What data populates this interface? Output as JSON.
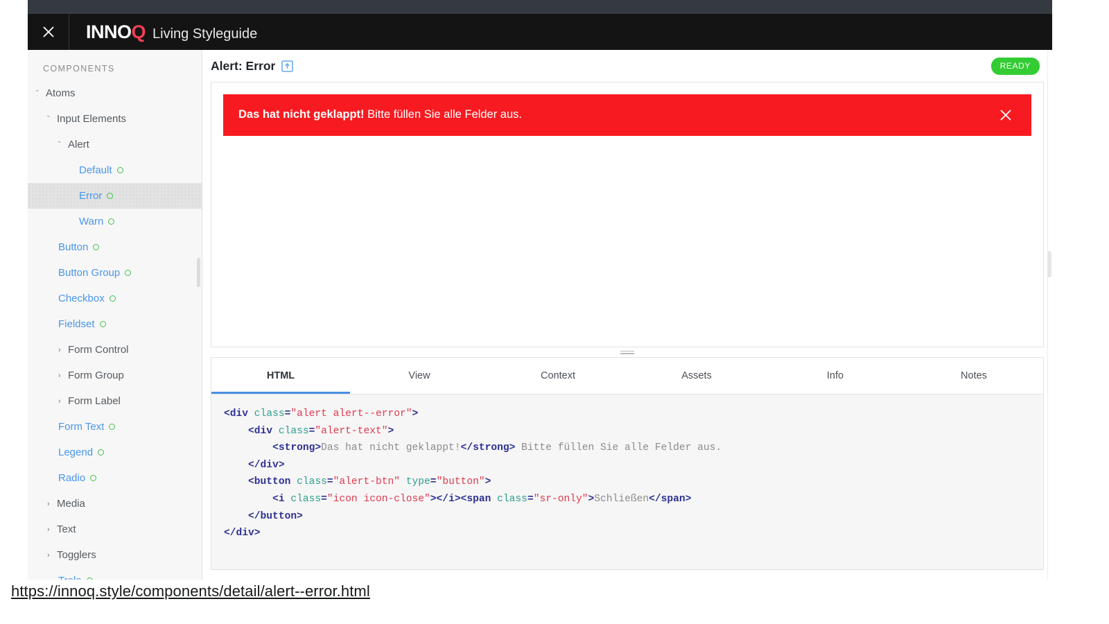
{
  "app": {
    "close_label": "×",
    "brand_main": "INNO",
    "brand_accent": "Q",
    "brand_sub": "Living Styleguide",
    "accent_color": "#ef4056",
    "header_bg": "#141414"
  },
  "sidebar": {
    "title": "COMPONENTS",
    "items": [
      {
        "label": "Atoms",
        "level": 0,
        "type": "branch",
        "expanded": true,
        "active": false
      },
      {
        "label": "Input Elements",
        "level": 1,
        "type": "branch",
        "expanded": true,
        "active": false
      },
      {
        "label": "Alert",
        "level": 2,
        "type": "branch",
        "expanded": true,
        "active": false
      },
      {
        "label": "Default",
        "level": 3,
        "type": "leaf",
        "status": "ready",
        "active": false
      },
      {
        "label": "Error",
        "level": 3,
        "type": "leaf",
        "status": "ready",
        "active": true
      },
      {
        "label": "Warn",
        "level": 3,
        "type": "leaf",
        "status": "ready",
        "active": false
      },
      {
        "label": "Button",
        "level": 2,
        "type": "leaf",
        "status": "ready",
        "active": false
      },
      {
        "label": "Button Group",
        "level": 2,
        "type": "leaf",
        "status": "ready",
        "active": false
      },
      {
        "label": "Checkbox",
        "level": 2,
        "type": "leaf",
        "status": "ready",
        "active": false
      },
      {
        "label": "Fieldset",
        "level": 2,
        "type": "leaf",
        "status": "ready",
        "active": false
      },
      {
        "label": "Form Control",
        "level": 2,
        "type": "branch",
        "expanded": false,
        "active": false
      },
      {
        "label": "Form Group",
        "level": 2,
        "type": "branch",
        "expanded": false,
        "active": false
      },
      {
        "label": "Form Label",
        "level": 2,
        "type": "branch",
        "expanded": false,
        "active": false
      },
      {
        "label": "Form Text",
        "level": 2,
        "type": "leaf",
        "status": "ready",
        "active": false
      },
      {
        "label": "Legend",
        "level": 2,
        "type": "leaf",
        "status": "ready",
        "active": false
      },
      {
        "label": "Radio",
        "level": 2,
        "type": "leaf",
        "status": "ready",
        "active": false
      },
      {
        "label": "Media",
        "level": 1,
        "type": "branch",
        "expanded": false,
        "active": false
      },
      {
        "label": "Text",
        "level": 1,
        "type": "branch",
        "expanded": false,
        "active": false
      },
      {
        "label": "Togglers",
        "level": 1,
        "type": "branch",
        "expanded": false,
        "active": false
      },
      {
        "label": "Trolo",
        "level": 2,
        "type": "leaf",
        "status": "ready",
        "active": false
      }
    ],
    "status_color": "#3fc14a",
    "link_color": "#4a96e8"
  },
  "main": {
    "title": "Alert: Error",
    "open_icon": "open-in-new-icon",
    "badge": "READY",
    "badge_color": "#33cc33"
  },
  "preview": {
    "alert": {
      "strong_text": "Das hat nicht geklappt!",
      "rest_text": " Bitte füllen Sie alle Felder aus.",
      "bg_color": "#f71b21",
      "close_label": "Schließen"
    }
  },
  "tabs": [
    {
      "label": "HTML",
      "active": true
    },
    {
      "label": "View",
      "active": false
    },
    {
      "label": "Context",
      "active": false
    },
    {
      "label": "Assets",
      "active": false
    },
    {
      "label": "Info",
      "active": false
    },
    {
      "label": "Notes",
      "active": false
    }
  ],
  "code": {
    "language": "html",
    "lines": [
      [
        {
          "t": "tag",
          "v": "<div "
        },
        {
          "t": "attr",
          "v": "class"
        },
        {
          "t": "tag",
          "v": "="
        },
        {
          "t": "val",
          "v": "\"alert alert--error\""
        },
        {
          "t": "tag",
          "v": ">"
        }
      ],
      [
        {
          "t": "plain",
          "v": "    "
        },
        {
          "t": "tag",
          "v": "<div "
        },
        {
          "t": "attr",
          "v": "class"
        },
        {
          "t": "tag",
          "v": "="
        },
        {
          "t": "val",
          "v": "\"alert-text\""
        },
        {
          "t": "tag",
          "v": ">"
        }
      ],
      [
        {
          "t": "plain",
          "v": "        "
        },
        {
          "t": "tag",
          "v": "<strong>"
        },
        {
          "t": "txt",
          "v": "Das hat nicht geklappt!"
        },
        {
          "t": "tag",
          "v": "</strong>"
        },
        {
          "t": "txt",
          "v": " Bitte füllen Sie alle Felder aus."
        }
      ],
      [
        {
          "t": "plain",
          "v": "    "
        },
        {
          "t": "tag",
          "v": "</div>"
        }
      ],
      [
        {
          "t": "plain",
          "v": "    "
        },
        {
          "t": "tag",
          "v": "<button "
        },
        {
          "t": "attr",
          "v": "class"
        },
        {
          "t": "tag",
          "v": "="
        },
        {
          "t": "val",
          "v": "\"alert-btn\""
        },
        {
          "t": "plain",
          "v": " "
        },
        {
          "t": "attr",
          "v": "type"
        },
        {
          "t": "tag",
          "v": "="
        },
        {
          "t": "val",
          "v": "\"button\""
        },
        {
          "t": "tag",
          "v": ">"
        }
      ],
      [
        {
          "t": "plain",
          "v": "        "
        },
        {
          "t": "tag",
          "v": "<i "
        },
        {
          "t": "attr",
          "v": "class"
        },
        {
          "t": "tag",
          "v": "="
        },
        {
          "t": "val",
          "v": "\"icon icon-close\""
        },
        {
          "t": "tag",
          "v": "></i><span "
        },
        {
          "t": "attr",
          "v": "class"
        },
        {
          "t": "tag",
          "v": "="
        },
        {
          "t": "val",
          "v": "\"sr-only\""
        },
        {
          "t": "tag",
          "v": ">"
        },
        {
          "t": "txt",
          "v": "Schließen"
        },
        {
          "t": "tag",
          "v": "</span>"
        }
      ],
      [
        {
          "t": "plain",
          "v": "    "
        },
        {
          "t": "tag",
          "v": "</button>"
        }
      ],
      [
        {
          "t": "tag",
          "v": "</div>"
        }
      ]
    ]
  },
  "status_bar": {
    "url": "https://innoq.style/components/detail/alert--error.html"
  }
}
